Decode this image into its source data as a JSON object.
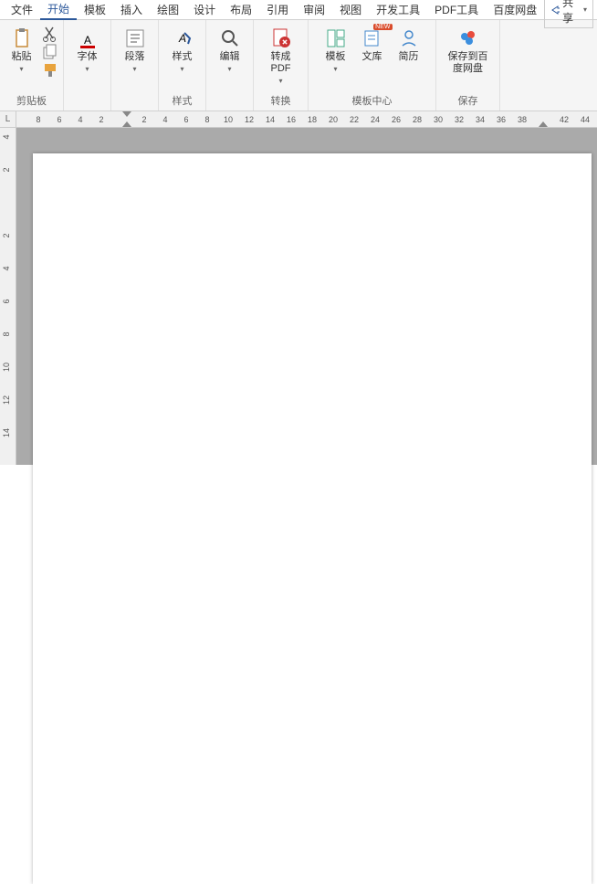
{
  "tabs": {
    "items": [
      "文件",
      "开始",
      "模板",
      "插入",
      "绘图",
      "设计",
      "布局",
      "引用",
      "审阅",
      "视图",
      "开发工具",
      "PDF工具",
      "百度网盘"
    ],
    "active_index": 1,
    "share": "共享"
  },
  "ribbon": {
    "clipboard": {
      "paste": "粘贴",
      "label": "剪贴板"
    },
    "font": {
      "label_btn": "字体"
    },
    "paragraph": {
      "label_btn": "段落"
    },
    "styles": {
      "label_btn": "样式",
      "label": "样式"
    },
    "editing": {
      "label_btn": "编辑"
    },
    "convert": {
      "to_pdf": "转成PDF",
      "label": "转换"
    },
    "template_center": {
      "template": "模板",
      "library": "文库",
      "resume": "简历",
      "label": "模板中心"
    },
    "save": {
      "save_to": "保存到百度网盘",
      "label": "保存"
    }
  },
  "ruler": {
    "h_ticks_left": [
      "8",
      "6",
      "4",
      "2"
    ],
    "h_ticks": [
      "2",
      "4",
      "6",
      "8",
      "10",
      "12",
      "14",
      "16",
      "18",
      "20",
      "22",
      "24",
      "26",
      "28",
      "30",
      "32",
      "34",
      "36",
      "38",
      "",
      "42",
      "44"
    ],
    "v_ticks": [
      "4",
      "2",
      "",
      "2",
      "4",
      "6",
      "8",
      "10",
      "12",
      "14"
    ],
    "corner": "L"
  }
}
